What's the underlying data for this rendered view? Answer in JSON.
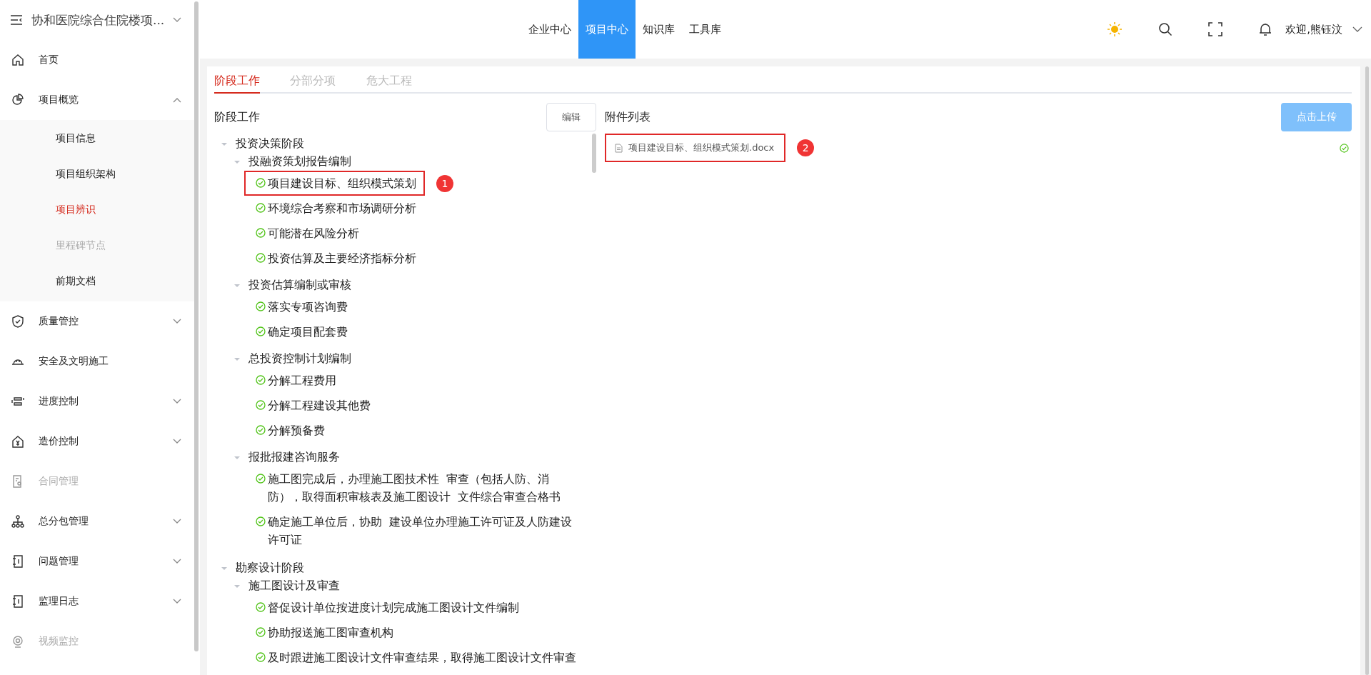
{
  "sidebar": {
    "title": "协和医院综合住院楼项...",
    "items": [
      {
        "label": "首页",
        "selected": false,
        "disabled": false
      },
      {
        "label": "项目概览",
        "expanded": true,
        "selected": false,
        "disabled": false,
        "children": [
          {
            "label": "项目信息",
            "selected": false,
            "disabled": false
          },
          {
            "label": "项目组织架构",
            "selected": false,
            "disabled": false
          },
          {
            "label": "项目辨识",
            "selected": true,
            "disabled": false
          },
          {
            "label": "里程碑节点",
            "selected": false,
            "disabled": true
          },
          {
            "label": "前期文档",
            "selected": false,
            "disabled": false
          }
        ]
      },
      {
        "label": "质量管控",
        "expanded": false,
        "selected": false,
        "disabled": false
      },
      {
        "label": "安全及文明施工",
        "selected": false,
        "disabled": false
      },
      {
        "label": "进度控制",
        "expanded": false,
        "selected": false,
        "disabled": false
      },
      {
        "label": "造价控制",
        "expanded": false,
        "selected": false,
        "disabled": false
      },
      {
        "label": "合同管理",
        "selected": false,
        "disabled": true
      },
      {
        "label": "总分包管理",
        "expanded": false,
        "selected": false,
        "disabled": false
      },
      {
        "label": "问题管理",
        "expanded": false,
        "selected": false,
        "disabled": false
      },
      {
        "label": "监理日志",
        "expanded": false,
        "selected": false,
        "disabled": false
      },
      {
        "label": "视频监控",
        "selected": false,
        "disabled": true
      }
    ]
  },
  "top_nav": [
    {
      "label": "企业中心",
      "selected": false
    },
    {
      "label": "项目中心",
      "selected": true
    },
    {
      "label": "知识库",
      "selected": false
    },
    {
      "label": "工具库",
      "selected": false
    }
  ],
  "user": {
    "greeting": "欢迎,熊钰汶"
  },
  "tabs": [
    {
      "label": "阶段工作",
      "selected": true
    },
    {
      "label": "分部分项",
      "selected": false
    },
    {
      "label": "危大工程",
      "selected": false
    }
  ],
  "stage_panel": {
    "title": "阶段工作",
    "edit_button": "编辑",
    "tree": [
      {
        "label": "投资决策阶段",
        "expanded": true,
        "children": [
          {
            "label": "投融资策划报告编制",
            "expanded": true,
            "children": [
              {
                "label": "项目建设目标、组织模式策划",
                "done": true,
                "highlighted": true,
                "marker": "1"
              },
              {
                "label": "环境综合考察和市场调研分析",
                "done": true,
                "highlighted": false
              },
              {
                "label": "可能潜在风险分析",
                "done": true,
                "highlighted": false
              },
              {
                "label": "投资估算及主要经济指标分析",
                "done": true,
                "highlighted": false
              }
            ]
          },
          {
            "label": "投资估算编制或审核",
            "expanded": true,
            "children": [
              {
                "label": "落实专项咨询费",
                "done": true,
                "highlighted": false
              },
              {
                "label": "确定项目配套费",
                "done": true,
                "highlighted": false
              }
            ]
          },
          {
            "label": "总投资控制计划编制",
            "expanded": true,
            "children": [
              {
                "label": "分解工程费用",
                "done": true,
                "highlighted": false
              },
              {
                "label": "分解工程建设其他费",
                "done": true,
                "highlighted": false
              },
              {
                "label": "分解预备费",
                "done": true,
                "highlighted": false
              }
            ]
          },
          {
            "label": "报批报建咨询服务",
            "expanded": true,
            "children": [
              {
                "label": "施工图完成后，办理施工图技术性  审查（包括人防、消防），取得面积审核表及施工图设计  文件综合审查合格书",
                "done": true,
                "highlighted": false
              },
              {
                "label": "确定施工单位后，协助  建设单位办理施工许可证及人防建设许可证",
                "done": true,
                "highlighted": false
              }
            ]
          }
        ]
      },
      {
        "label": "勘察设计阶段",
        "expanded": true,
        "children": [
          {
            "label": "施工图设计及审查",
            "expanded": true,
            "children": [
              {
                "label": "督促设计单位按进度计划完成施工图设计文件编制",
                "done": true,
                "highlighted": false
              },
              {
                "label": "协助报送施工图审查机构",
                "done": true,
                "highlighted": false
              },
              {
                "label": "及时跟进施工图设计文件审查结果，取得施工图设计文件审查",
                "done": true,
                "highlighted": false
              }
            ]
          }
        ]
      }
    ]
  },
  "attachments": {
    "title": "附件列表",
    "upload_button": "点击上传",
    "files": [
      {
        "name": "项目建设目标、组织模式策划.docx",
        "uploaded": true,
        "highlighted": true,
        "marker": "2"
      }
    ]
  }
}
